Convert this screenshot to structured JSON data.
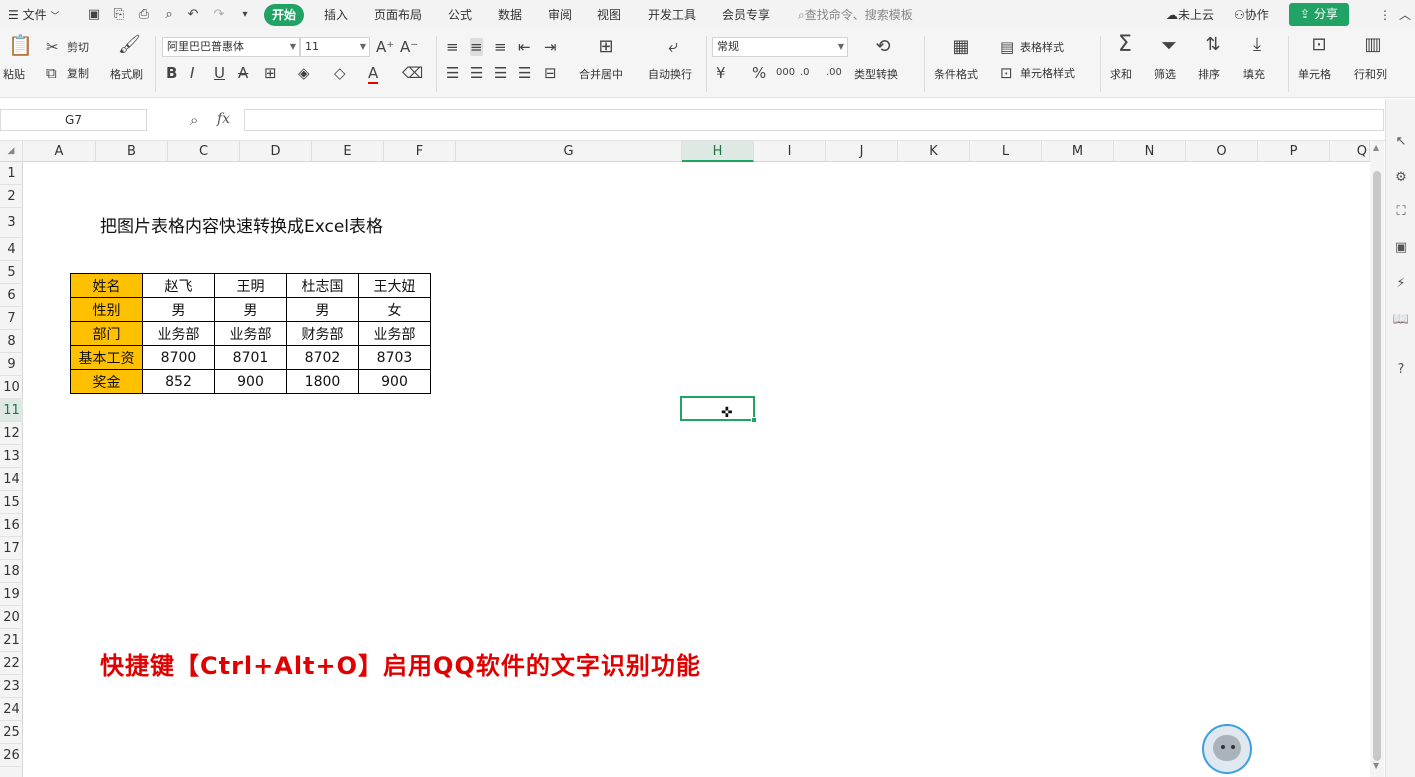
{
  "topbar": {
    "file_label": "文件",
    "tabs": [
      "开始",
      "插入",
      "页面布局",
      "公式",
      "数据",
      "审阅",
      "视图",
      "开发工具",
      "会员专享"
    ],
    "search_placeholder": "查找命令、搜索模板",
    "cloud_label": "未上云",
    "collab_label": "协作",
    "share_label": "分享"
  },
  "ribbon": {
    "paste": "粘贴",
    "cut": "剪切",
    "copy": "复制",
    "format_painter": "格式刷",
    "font_name": "阿里巴巴普惠体",
    "font_size": "11",
    "merge_center": "合并居中",
    "wrap_text": "自动换行",
    "number_format": "常规",
    "type_convert": "类型转换",
    "cond_format": "条件格式",
    "table_style": "表格样式",
    "cell_style": "单元格样式",
    "sum": "求和",
    "filter": "筛选",
    "sort": "排序",
    "fill": "填充",
    "cell": "单元格",
    "row_col": "行和列"
  },
  "formula_bar": {
    "name_box": "G7",
    "fx": "fx",
    "value": ""
  },
  "grid": {
    "columns": [
      "A",
      "B",
      "C",
      "D",
      "E",
      "F",
      "G",
      "H",
      "I",
      "J",
      "K",
      "L",
      "M",
      "N",
      "O",
      "P",
      "Q"
    ],
    "rows": [
      "1",
      "2",
      "3",
      "4",
      "5",
      "6",
      "7",
      "8",
      "9",
      "10",
      "11",
      "12",
      "13",
      "14",
      "15",
      "16",
      "17",
      "18",
      "19",
      "20",
      "21",
      "22",
      "23",
      "24",
      "25",
      "26"
    ],
    "selected_column": "H",
    "selected_row": "11"
  },
  "sheet": {
    "title": "把图片表格内容快速转换成Excel表格",
    "table": [
      [
        "姓名",
        "赵飞",
        "王明",
        "杜志国",
        "王大妞"
      ],
      [
        "性别",
        "男",
        "男",
        "男",
        "女"
      ],
      [
        "部门",
        "业务部",
        "业务部",
        "财务部",
        "业务部"
      ],
      [
        "基本工资",
        "8700",
        "8701",
        "8702",
        "8703"
      ],
      [
        "奖金",
        "852",
        "900",
        "1800",
        "900"
      ]
    ],
    "note": "快捷键【Ctrl+Alt+O】启用QQ软件的文字识别功能"
  },
  "colors": {
    "accent": "#21a366",
    "header_fill": "#ffc000",
    "note_color": "#e00000"
  }
}
